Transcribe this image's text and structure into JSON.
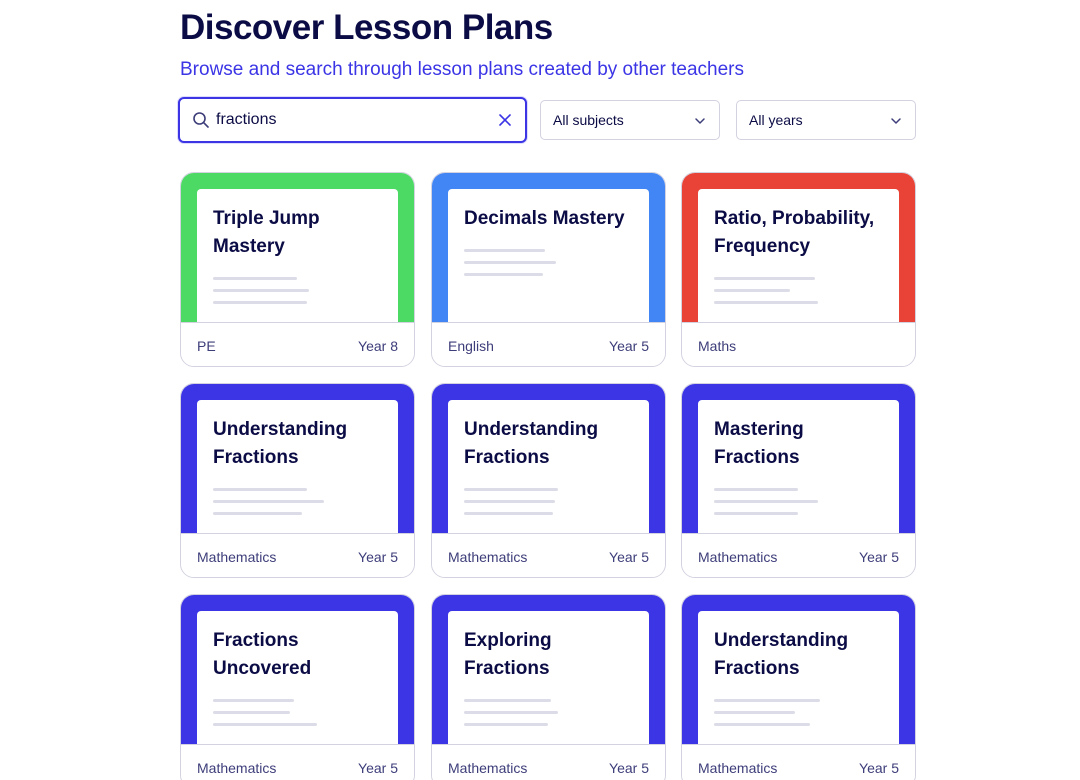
{
  "header": {
    "title": "Discover Lesson Plans",
    "subtitle": "Browse and search through lesson plans created by other teachers"
  },
  "search": {
    "value": "fractions",
    "icon": "search-icon",
    "clear_icon": "close-icon"
  },
  "filters": {
    "subjects": {
      "selected": "All subjects"
    },
    "years": {
      "selected": "All years"
    }
  },
  "colors": {
    "accent": "#3b35e6",
    "pe": "#4cd964",
    "english": "#4285f4",
    "maths_red": "#e84336",
    "mathematics": "#3b35e6",
    "heading": "#0b0b45"
  },
  "cards": [
    {
      "title": "Triple Jump Mastery",
      "subject": "PE",
      "year": "Year 8",
      "color": "#4cd964",
      "lines": [
        0.5,
        0.57,
        0.56
      ]
    },
    {
      "title": "Decimals Mastery",
      "subject": "English",
      "year": "Year 5",
      "color": "#4285f4",
      "lines": [
        0.48,
        0.55,
        0.47
      ]
    },
    {
      "title": "Ratio, Probability, Frequency",
      "subject": "Maths",
      "year": "",
      "color": "#e84336",
      "lines": [
        0.6,
        0.45,
        0.62
      ]
    },
    {
      "title": "Understanding Fractions",
      "subject": "Mathematics",
      "year": "Year 5",
      "color": "#3b35e6",
      "lines": [
        0.56,
        0.66,
        0.53
      ]
    },
    {
      "title": "Understanding Fractions",
      "subject": "Mathematics",
      "year": "Year 5",
      "color": "#3b35e6",
      "lines": [
        0.56,
        0.54,
        0.53
      ]
    },
    {
      "title": "Mastering Fractions",
      "subject": "Mathematics",
      "year": "Year 5",
      "color": "#3b35e6",
      "lines": [
        0.5,
        0.62,
        0.5
      ]
    },
    {
      "title": "Fractions Uncovered",
      "subject": "Mathematics",
      "year": "Year 5",
      "color": "#3b35e6",
      "lines": [
        0.48,
        0.46,
        0.62
      ]
    },
    {
      "title": "Exploring Fractions",
      "subject": "Mathematics",
      "year": "Year 5",
      "color": "#3b35e6",
      "lines": [
        0.52,
        0.56,
        0.5
      ]
    },
    {
      "title": "Understanding Fractions",
      "subject": "Mathematics",
      "year": "Year 5",
      "color": "#3b35e6",
      "lines": [
        0.63,
        0.48,
        0.57
      ]
    }
  ]
}
